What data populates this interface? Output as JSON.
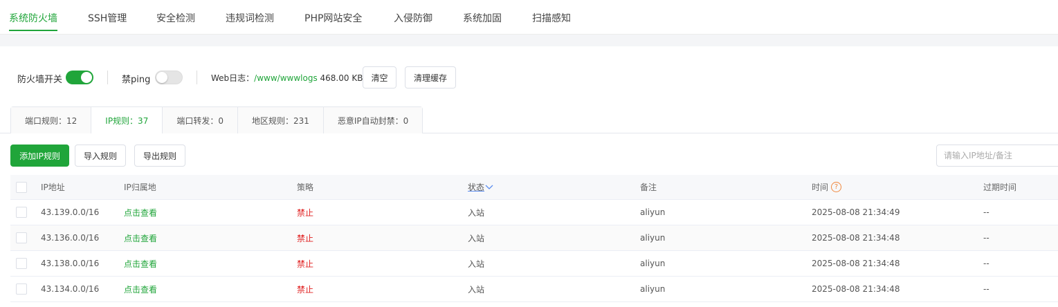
{
  "nav": {
    "tabs": [
      {
        "label": "系统防火墙",
        "active": true
      },
      {
        "label": "SSH管理"
      },
      {
        "label": "安全检测"
      },
      {
        "label": "违规词检测"
      },
      {
        "label": "PHP网站安全"
      },
      {
        "label": "入侵防御"
      },
      {
        "label": "系统加固"
      },
      {
        "label": "扫描感知"
      }
    ]
  },
  "toolbar": {
    "firewall_label": "防火墙开关",
    "firewall_on": true,
    "ping_label": "禁ping",
    "ping_on": false,
    "weblog_label": "Web日志：",
    "weblog_path": "/www/wwwlogs",
    "weblog_size": "468.00 KB",
    "clear_label": "清空",
    "clear_cache_label": "清理缓存"
  },
  "subtabs": [
    {
      "label": "端口规则：12"
    },
    {
      "label": "IP规则：37",
      "active": true
    },
    {
      "label": "端口转发：0"
    },
    {
      "label": "地区规则：231"
    },
    {
      "label": "恶意IP自动封禁：0"
    }
  ],
  "actions": {
    "add_label": "添加IP规则",
    "import_label": "导入规则",
    "export_label": "导出规则",
    "search_placeholder": "请输入IP地址/备注"
  },
  "table": {
    "headers": {
      "ip": "IP地址",
      "location": "IP归属地",
      "policy": "策略",
      "status": "状态",
      "remark": "备注",
      "time": "时间",
      "expire": "过期时间"
    },
    "rows": [
      {
        "ip": "43.139.0.0/16",
        "location": "点击查看",
        "policy": "禁止",
        "status": "入站",
        "remark": "aliyun",
        "time": "2025-08-08 21:34:49",
        "expire": "--"
      },
      {
        "ip": "43.136.0.0/16",
        "location": "点击查看",
        "policy": "禁止",
        "status": "入站",
        "remark": "aliyun",
        "time": "2025-08-08 21:34:48",
        "expire": "--"
      },
      {
        "ip": "43.138.0.0/16",
        "location": "点击查看",
        "policy": "禁止",
        "status": "入站",
        "remark": "aliyun",
        "time": "2025-08-08 21:34:48",
        "expire": "--"
      },
      {
        "ip": "43.134.0.0/16",
        "location": "点击查看",
        "policy": "禁止",
        "status": "入站",
        "remark": "aliyun",
        "time": "2025-08-08 21:34:48",
        "expire": "--"
      }
    ]
  },
  "colors": {
    "accent": "#20a53a",
    "deny": "#e02020",
    "help": "#f0883e"
  }
}
